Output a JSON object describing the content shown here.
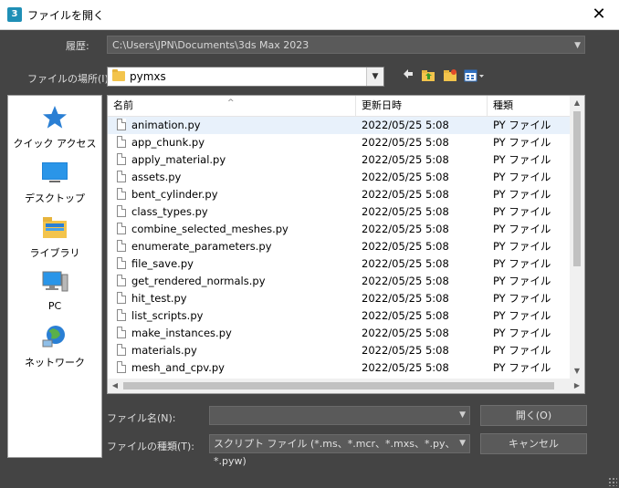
{
  "window": {
    "icon_label": "3",
    "title": "ファイルを開く",
    "close_glyph": "✕"
  },
  "history": {
    "label": "履歴:",
    "value": "C:\\Users\\JPN\\Documents\\3ds Max 2023"
  },
  "location": {
    "label": "ファイルの場所(I):",
    "value": "pymxs"
  },
  "toolbar": {
    "back_icon": "back-arrow-icon",
    "up_icon": "up-folder-icon",
    "new_folder_icon": "new-folder-icon",
    "view_menu_icon": "view-menu-icon"
  },
  "places": [
    {
      "label": "クイック アクセス",
      "icon": "star-icon"
    },
    {
      "label": "デスクトップ",
      "icon": "desktop-icon"
    },
    {
      "label": "ライブラリ",
      "icon": "library-icon"
    },
    {
      "label": "PC",
      "icon": "pc-icon"
    },
    {
      "label": "ネットワーク",
      "icon": "network-icon"
    }
  ],
  "columns": {
    "name": "名前",
    "date": "更新日時",
    "type": "種類"
  },
  "files": [
    {
      "name": "animation.py",
      "date": "2022/05/25 5:08",
      "type": "PY ファイル"
    },
    {
      "name": "app_chunk.py",
      "date": "2022/05/25 5:08",
      "type": "PY ファイル"
    },
    {
      "name": "apply_material.py",
      "date": "2022/05/25 5:08",
      "type": "PY ファイル"
    },
    {
      "name": "assets.py",
      "date": "2022/05/25 5:08",
      "type": "PY ファイル"
    },
    {
      "name": "bent_cylinder.py",
      "date": "2022/05/25 5:08",
      "type": "PY ファイル"
    },
    {
      "name": "class_types.py",
      "date": "2022/05/25 5:08",
      "type": "PY ファイル"
    },
    {
      "name": "combine_selected_meshes.py",
      "date": "2022/05/25 5:08",
      "type": "PY ファイル"
    },
    {
      "name": "enumerate_parameters.py",
      "date": "2022/05/25 5:08",
      "type": "PY ファイル"
    },
    {
      "name": "file_save.py",
      "date": "2022/05/25 5:08",
      "type": "PY ファイル"
    },
    {
      "name": "get_rendered_normals.py",
      "date": "2022/05/25 5:08",
      "type": "PY ファイル"
    },
    {
      "name": "hit_test.py",
      "date": "2022/05/25 5:08",
      "type": "PY ファイル"
    },
    {
      "name": "list_scripts.py",
      "date": "2022/05/25 5:08",
      "type": "PY ファイル"
    },
    {
      "name": "make_instances.py",
      "date": "2022/05/25 5:08",
      "type": "PY ファイル"
    },
    {
      "name": "materials.py",
      "date": "2022/05/25 5:08",
      "type": "PY ファイル"
    },
    {
      "name": "mesh_and_cpv.py",
      "date": "2022/05/25 5:08",
      "type": "PY ファイル"
    }
  ],
  "file_name": {
    "label": "ファイル名(N):",
    "value": ""
  },
  "file_type": {
    "label": "ファイルの種類(T):",
    "value": "スクリプト ファイル (*.ms、*.mcr、*.mxs、*.py、*.pyw)"
  },
  "buttons": {
    "open": "開く(O)",
    "cancel": "キャンセル"
  },
  "colors": {
    "dialog_bg": "#444444",
    "selected_row": "#e8f1fb",
    "folder": "#f3c44c"
  }
}
